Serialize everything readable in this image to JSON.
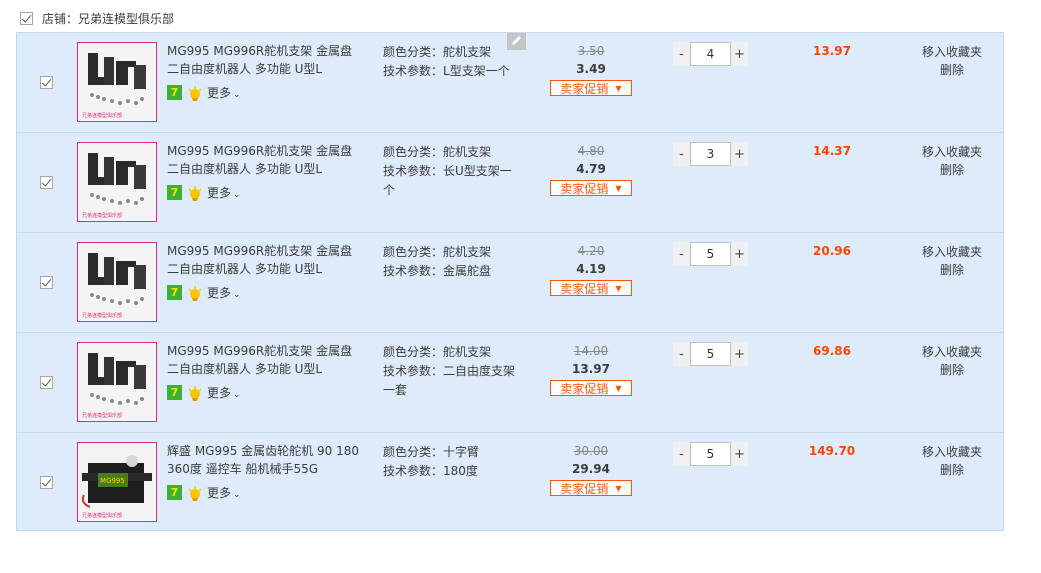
{
  "shop": {
    "label": "店铺：兄弟连模型俱乐部"
  },
  "colors": {
    "accent": "#ff4400",
    "row_bg": "#deebfa",
    "badge_green": "#3cb134"
  },
  "items": [
    {
      "title": "MG995 MG996R舵机支架 金属盘 二自由度机器人 多功能 U型L",
      "more": "更多",
      "badge": "7",
      "color_label": "颜色分类：",
      "color_value": "舵机支架",
      "spec_label": "技术参数：",
      "spec_value": "L型支架一个",
      "orig_price": "3.50",
      "price": "3.49",
      "promo": "卖家促销",
      "qty": "4",
      "total": "13.97",
      "fav": "移入收藏夹",
      "del": "删除",
      "image": "bracket-photo"
    },
    {
      "title": "MG995 MG996R舵机支架 金属盘 二自由度机器人 多功能 U型L",
      "more": "更多",
      "badge": "7",
      "color_label": "颜色分类：",
      "color_value": "舵机支架",
      "spec_label": "技术参数：",
      "spec_value": "长U型支架一个",
      "orig_price": "4.80",
      "price": "4.79",
      "promo": "卖家促销",
      "qty": "3",
      "total": "14.37",
      "fav": "移入收藏夹",
      "del": "删除",
      "image": "bracket-photo"
    },
    {
      "title": "MG995 MG996R舵机支架 金属盘 二自由度机器人 多功能 U型L",
      "more": "更多",
      "badge": "7",
      "color_label": "颜色分类：",
      "color_value": "舵机支架",
      "spec_label": "技术参数：",
      "spec_value": "金属舵盘",
      "orig_price": "4.20",
      "price": "4.19",
      "promo": "卖家促销",
      "qty": "5",
      "total": "20.96",
      "fav": "移入收藏夹",
      "del": "删除",
      "image": "bracket-photo"
    },
    {
      "title": "MG995 MG996R舵机支架 金属盘 二自由度机器人 多功能 U型L",
      "more": "更多",
      "badge": "7",
      "color_label": "颜色分类：",
      "color_value": "舵机支架",
      "spec_label": "技术参数：",
      "spec_value": "二自由度支架一套",
      "orig_price": "14.00",
      "price": "13.97",
      "promo": "卖家促销",
      "qty": "5",
      "total": "69.86",
      "fav": "移入收藏夹",
      "del": "删除",
      "image": "bracket-photo"
    },
    {
      "title": "辉盛 MG995 金属齿轮舵机 90 180 360度 遥控车 船机械手55G",
      "more": "更多",
      "badge": "7",
      "color_label": "颜色分类：",
      "color_value": "十字臂",
      "spec_label": "技术参数：",
      "spec_value": "180度",
      "orig_price": "30.00",
      "price": "29.94",
      "promo": "卖家促销",
      "qty": "5",
      "total": "149.70",
      "fav": "移入收藏夹",
      "del": "删除",
      "image": "servo-photo"
    }
  ]
}
